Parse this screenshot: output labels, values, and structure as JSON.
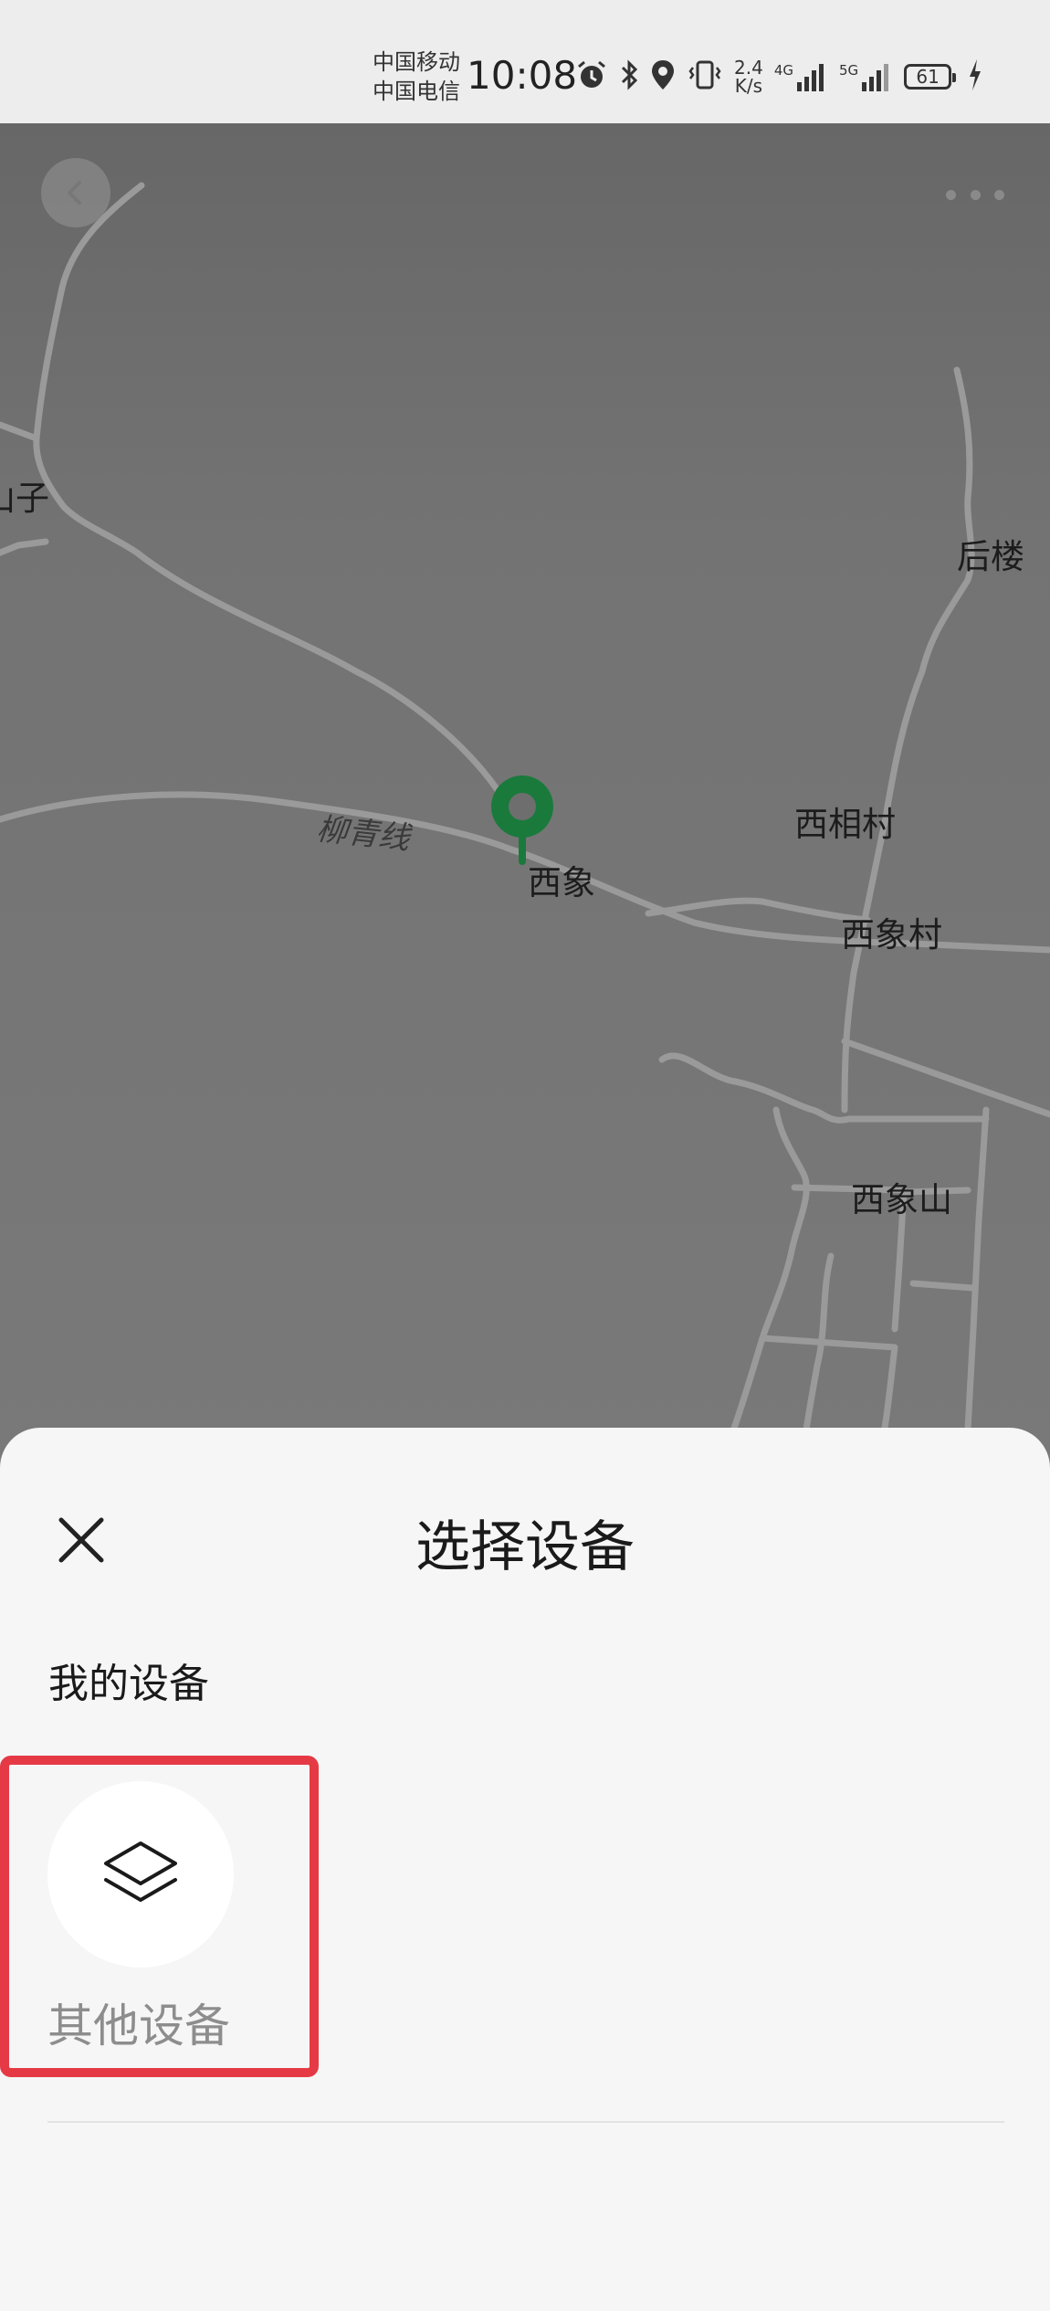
{
  "status_bar": {
    "carrier_1": "中国移动",
    "carrier_2": "中国电信",
    "time": "10:08",
    "net_speed_value": "2.4",
    "net_speed_unit": "K/s",
    "signal_1_label": "4G",
    "signal_2_label": "5G",
    "battery_level": "61",
    "icons": [
      "alarm-icon",
      "bluetooth-icon",
      "location-icon",
      "vibrate-icon",
      "signal-icon",
      "signal-icon",
      "battery-icon",
      "charging-icon"
    ]
  },
  "map": {
    "labels": {
      "partial_left": "山子",
      "houlou": "后楼",
      "xixiangcun_top": "西相村",
      "xixiang": "西象",
      "xixiangcun": "西象村",
      "xixiangshan": "西象山",
      "road": "柳青线"
    },
    "pin_color": "#1a7a3c"
  },
  "sheet": {
    "title": "选择设备",
    "section_label": "我的设备",
    "devices": [
      {
        "label": "其他设备",
        "icon": "layers-icon"
      }
    ],
    "highlight_color": "#e53a45"
  }
}
